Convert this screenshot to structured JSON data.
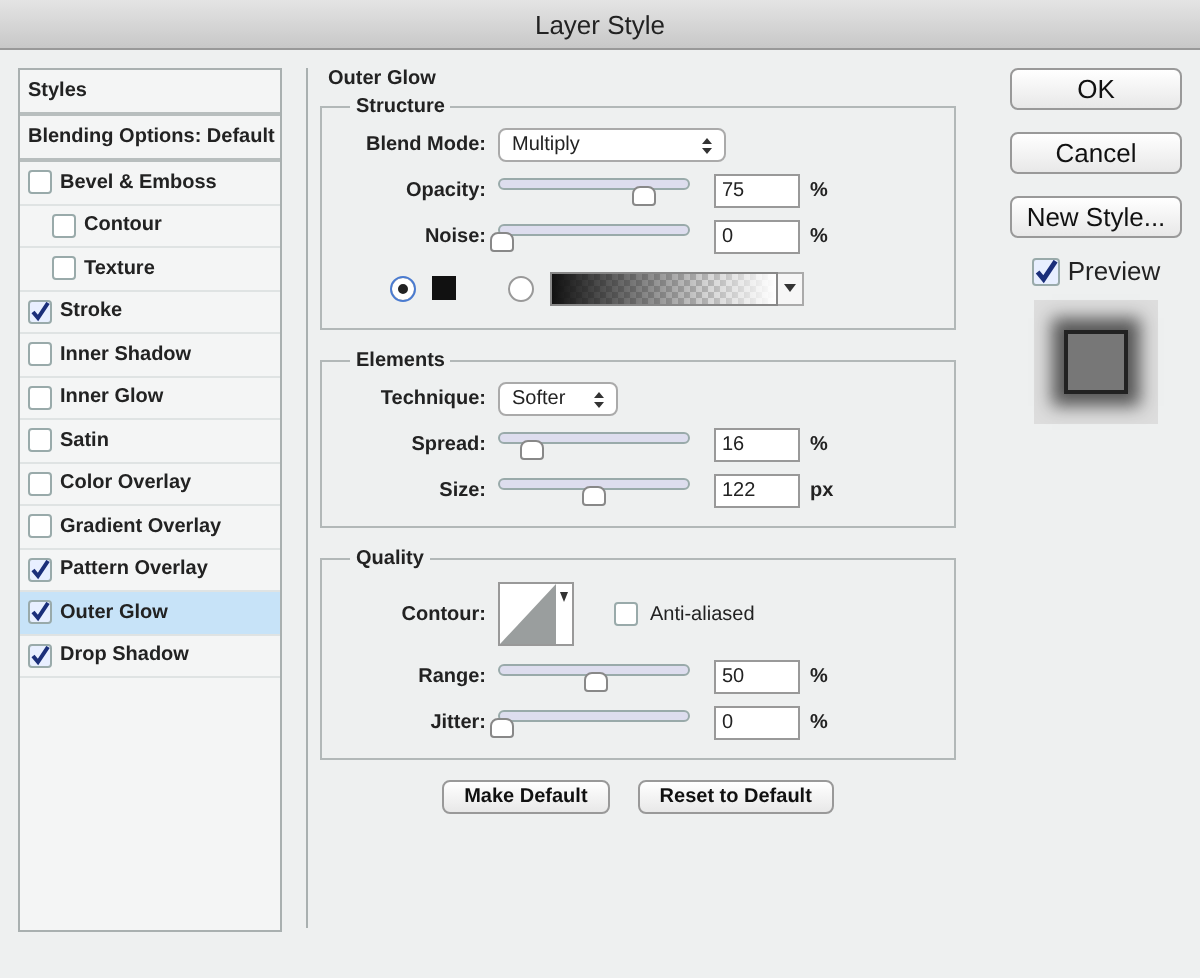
{
  "window": {
    "title": "Layer Style"
  },
  "styles_panel": {
    "header": "Styles",
    "items": [
      {
        "kind": "header",
        "label": "Blending Options: Default",
        "selected": false
      },
      {
        "kind": "check",
        "label": "Bevel & Emboss",
        "checked": false,
        "selected": false,
        "children": [
          {
            "kind": "check",
            "label": "Contour",
            "checked": false,
            "selected": false
          },
          {
            "kind": "check",
            "label": "Texture",
            "checked": false,
            "selected": false
          }
        ]
      },
      {
        "kind": "check",
        "label": "Stroke",
        "checked": true,
        "selected": false
      },
      {
        "kind": "check",
        "label": "Inner Shadow",
        "checked": false,
        "selected": false
      },
      {
        "kind": "check",
        "label": "Inner Glow",
        "checked": false,
        "selected": false
      },
      {
        "kind": "check",
        "label": "Satin",
        "checked": false,
        "selected": false
      },
      {
        "kind": "check",
        "label": "Color Overlay",
        "checked": false,
        "selected": false
      },
      {
        "kind": "check",
        "label": "Gradient Overlay",
        "checked": false,
        "selected": false
      },
      {
        "kind": "check",
        "label": "Pattern Overlay",
        "checked": true,
        "selected": false
      },
      {
        "kind": "check",
        "label": "Outer Glow",
        "checked": true,
        "selected": true
      },
      {
        "kind": "check",
        "label": "Drop Shadow",
        "checked": true,
        "selected": false
      }
    ]
  },
  "outer_glow": {
    "title": "Outer Glow",
    "structure": {
      "title": "Structure",
      "blend_mode": {
        "label": "Blend Mode:",
        "value": "Multiply"
      },
      "sliders": [
        {
          "label": "Opacity:",
          "level": 0.75,
          "value": "75",
          "unit": "%"
        },
        {
          "label": "Noise:",
          "level": 0,
          "value": "0",
          "unit": "%"
        }
      ],
      "sources": [
        {
          "kind": "color",
          "selected": true
        },
        {
          "kind": "gradient",
          "selected": false
        }
      ]
    },
    "elements": {
      "title": "Elements",
      "technique": {
        "label": "Technique:",
        "value": "Softer"
      },
      "sliders": [
        {
          "label": "Spread:",
          "level": 0.16,
          "value": "16",
          "unit": "%"
        },
        {
          "label": "Size:",
          "level": 0.49,
          "value": "122",
          "unit": "px"
        }
      ]
    },
    "quality": {
      "title": "Quality",
      "contour_label": "Contour:",
      "anti_aliased": {
        "label": "Anti-aliased",
        "checked": false
      },
      "sliders": [
        {
          "label": "Range:",
          "level": 0.5,
          "value": "50",
          "unit": "%"
        },
        {
          "label": "Jitter:",
          "level": 0,
          "value": "0",
          "unit": "%"
        }
      ]
    },
    "buttons": [
      "Make Default",
      "Reset to Default"
    ]
  },
  "side_buttons": [
    "OK",
    "Cancel",
    "New Style..."
  ],
  "preview": {
    "label": "Preview",
    "checked": true
  }
}
